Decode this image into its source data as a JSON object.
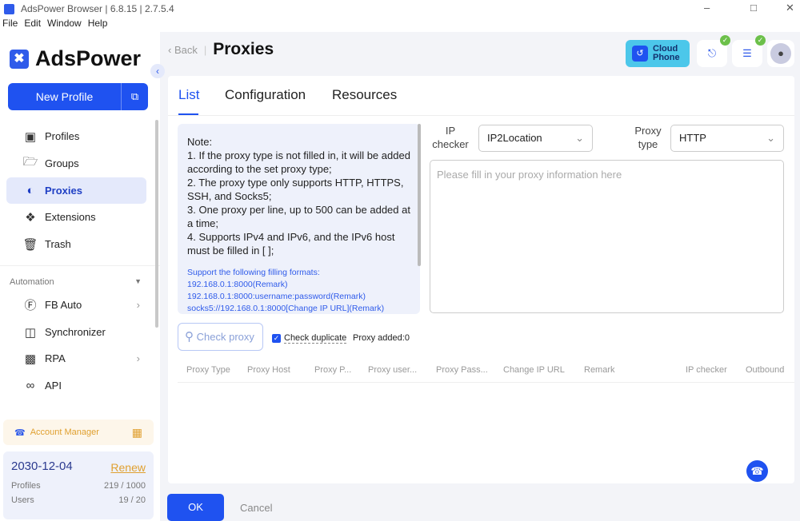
{
  "window": {
    "title": "AdsPower Browser | 6.8.15 | 2.7.5.4"
  },
  "menu": [
    "File",
    "Edit",
    "Window",
    "Help"
  ],
  "sidebar": {
    "brand": "AdsPower",
    "new_profile": "New Profile",
    "items": [
      {
        "label": "Profiles"
      },
      {
        "label": "Groups"
      },
      {
        "label": "Proxies"
      },
      {
        "label": "Extensions"
      },
      {
        "label": "Trash"
      }
    ],
    "automation_label": "Automation",
    "automation": [
      {
        "label": "FB Auto"
      },
      {
        "label": "Synchronizer"
      },
      {
        "label": "RPA"
      },
      {
        "label": "API"
      }
    ],
    "account_manager": "Account Manager",
    "plan": {
      "date": "2030-12-04",
      "renew": "Renew",
      "profiles_label": "Profiles",
      "profiles_value": "219 / 1000",
      "users_label": "Users",
      "users_value": "19 / 20"
    }
  },
  "header": {
    "back": "Back",
    "title": "Proxies",
    "cloud_phone": [
      "Cloud",
      "Phone"
    ]
  },
  "tabs": [
    "List",
    "Configuration",
    "Resources"
  ],
  "note": {
    "lines": [
      "Note:",
      "1. If the proxy type is not filled in, it will be added according to the set proxy type;",
      "2. The proxy type only supports HTTP, HTTPS, SSH, and Socks5;",
      "3. One proxy per line, up to 500 can be added at a time;",
      "4. Supports IPv4 and IPv6, and the IPv6 host must be filled in [ ];"
    ],
    "formats": [
      "Support the following filling formats:",
      "192.168.0.1:8000(Remark)",
      "192.168.0.1:8000:username:password(Remark)",
      "socks5://192.168.0.1:8000[Change IP URL](Remark)"
    ]
  },
  "form": {
    "ip_checker_label": "IP checker",
    "ip_checker_value": "IP2Location",
    "proxy_type_label": "Proxy type",
    "proxy_type_value": "HTTP",
    "placeholder": "Please fill in your proxy information here"
  },
  "actions": {
    "check_proxy": "Check proxy",
    "check_duplicate": "Check duplicate",
    "proxy_added": "Proxy added:0"
  },
  "table": {
    "columns": [
      "Proxy Type",
      "Proxy Host",
      "Proxy P...",
      "Proxy user...",
      "Proxy Pass...",
      "Change IP URL",
      "Remark",
      "IP checker",
      "Outbound"
    ]
  },
  "footer": {
    "ok": "OK",
    "cancel": "Cancel"
  }
}
